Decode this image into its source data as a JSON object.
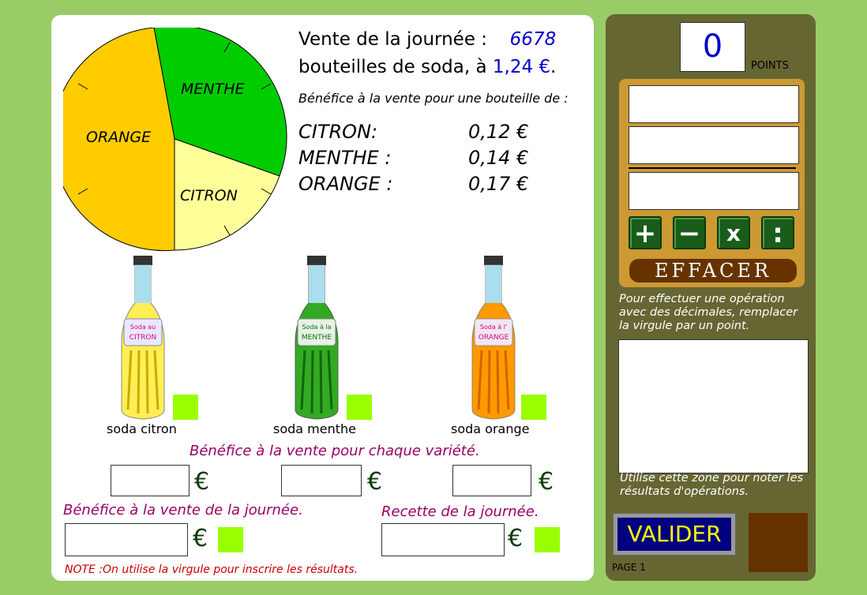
{
  "header": {
    "sales_label": "Vente de la journée :",
    "sales_count": "6678",
    "bottles_text": "bouteilles de soda, à",
    "price": "1,24 €",
    "period": ".",
    "benefit_title": "Bénéfice à la vente pour une bouteille de :"
  },
  "profits": [
    {
      "name": "CITRON:",
      "value": "0,12 €"
    },
    {
      "name": "MENTHE :",
      "value": "0,14 €"
    },
    {
      "name": "ORANGE :",
      "value": "0,17 €"
    }
  ],
  "pie": {
    "slices": [
      {
        "label": "MENTHE",
        "color": "#00cc00"
      },
      {
        "label": "CITRON",
        "color": "#ffff99"
      },
      {
        "label": "ORANGE",
        "color": "#ffcc00"
      }
    ]
  },
  "bottles": [
    {
      "label": "soda citron",
      "tag_line1": "Soda au",
      "tag_line2": "CITRON",
      "color": "#ffee55"
    },
    {
      "label": "soda menthe",
      "tag_line1": "Soda à la",
      "tag_line2": "MENTHE",
      "color": "#33aa22"
    },
    {
      "label": "soda orange",
      "tag_line1": "Soda à l'",
      "tag_line2": "ORANGE",
      "color": "#ff9900"
    }
  ],
  "labels": {
    "variety_benefit": "Bénéfice à la vente  pour chaque variété.",
    "day_benefit": "Bénéfice à la vente de la journée.",
    "day_receipt": "Recette de la journée.",
    "euro": "€",
    "note": "NOTE :On utilise la virgule pour inscrire les résultats."
  },
  "sidebar": {
    "score": "0",
    "points_label": "POINTS",
    "ops": [
      "+",
      "−",
      "x",
      ":"
    ],
    "clear_label": "EFFACER",
    "decimal_hint": "Pour effectuer une opération avec des décimales, remplacer la virgule par un point.",
    "notes_hint": "Utilise cette zone pour noter les résultats d'opérations.",
    "validate_label": "VALIDER",
    "page_label": "PAGE 1"
  }
}
